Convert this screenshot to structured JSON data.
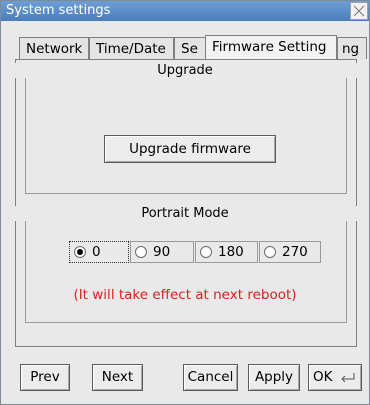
{
  "window": {
    "title": "System settings"
  },
  "tabs": [
    {
      "label": "Network"
    },
    {
      "label": "Time/Date"
    },
    {
      "label": "Se"
    },
    {
      "label": "Firmware Setting"
    },
    {
      "label": "ng"
    }
  ],
  "upgrade": {
    "group_title": "Upgrade",
    "button_label": "Upgrade firmware"
  },
  "portrait": {
    "group_title": "Portrait Mode",
    "options": [
      {
        "label": "0",
        "selected": true
      },
      {
        "label": "90",
        "selected": false
      },
      {
        "label": "180",
        "selected": false
      },
      {
        "label": "270",
        "selected": false
      }
    ],
    "notice": "(It will take effect at next reboot)"
  },
  "footer": {
    "prev_label": "Prev",
    "next_label": "Next",
    "cancel_label": "Cancel",
    "apply_label": "Apply",
    "ok_label": "OK"
  },
  "icons": {
    "close": "close-icon",
    "enter": "enter-icon"
  },
  "colors": {
    "titlebar": "#4a7dbd",
    "notice": "#e02020"
  }
}
